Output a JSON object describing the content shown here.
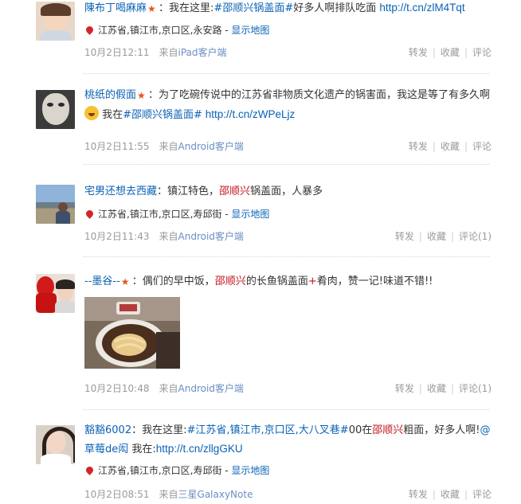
{
  "posts": [
    {
      "user": "陳布丁喝麻麻",
      "colon": "：",
      "text_parts": [
        "我在这里:",
        "#邵顺兴锅盖面#",
        "好多人啊排队吃面 ",
        "http://t.cn/zlM4Tqt"
      ],
      "location": "江苏省,镇江市,京口区,永安路",
      "map_link": "显示地图",
      "time": "10月2日12:11",
      "source_prefix": "来自",
      "source": "iPad客户端",
      "actions": [
        "转发",
        "收藏",
        "评论"
      ]
    },
    {
      "user": "桃纸的假面",
      "colon": "：",
      "text_parts": [
        "为了吃碗传说中的江苏省非物质文化遗产的锅害面，我这是等了有多久啊",
        " 我在",
        "#邵顺兴锅盖面#",
        " http://t.cn/zWPeLjz"
      ],
      "time": "10月2日11:55",
      "source_prefix": "来自",
      "source": "Android客户端",
      "actions": [
        "转发",
        "收藏",
        "评论"
      ]
    },
    {
      "user": "宅男还想去西藏",
      "colon": "：",
      "text_parts": [
        "镇江特色，",
        "邵顺兴",
        "锅盖面，人暴多"
      ],
      "location": "江苏省,镇江市,京口区,寿邱街",
      "map_link": "显示地图",
      "time": "10月2日11:43",
      "source_prefix": "来自",
      "source": "Android客户端",
      "actions": [
        "转发",
        "收藏",
        "评论(1)"
      ]
    },
    {
      "user": "--墨谷--",
      "colon": "：",
      "text_parts": [
        "偶们的早中饭，",
        "邵顺兴",
        "的长鱼锅盖面",
        "+",
        "肴肉，赞一记!味道不错!!"
      ],
      "time": "10月2日10:48",
      "source_prefix": "来自",
      "source": "Android客户端",
      "actions": [
        "转发",
        "收藏",
        "评论(1)"
      ]
    },
    {
      "user": "豁豁6002",
      "colon": "：",
      "text_parts": [
        "我在这里:",
        "#江苏省,镇江市,京口区,大八叉巷#",
        "00在",
        "邵顺兴",
        "粗面，好多人啊!",
        "@草莓de闳",
        " 我在:",
        "http://t.cn/zllgGKU"
      ],
      "location": "江苏省,镇江市,京口区,寿邱街",
      "map_link": "显示地图",
      "time": "10月2日08:51",
      "source_prefix": "来自",
      "source": "三星GalaxyNote",
      "actions": [
        "转发",
        "收藏",
        "评论"
      ]
    }
  ],
  "icons": {
    "medal": "medal-icon",
    "pin": "location-pin-icon",
    "emoji": "crying-emoji-icon"
  },
  "colors": {
    "link_blue": "#0a62b5",
    "highlight_red": "#c4151c",
    "meta_gray": "#9a9a9a"
  }
}
